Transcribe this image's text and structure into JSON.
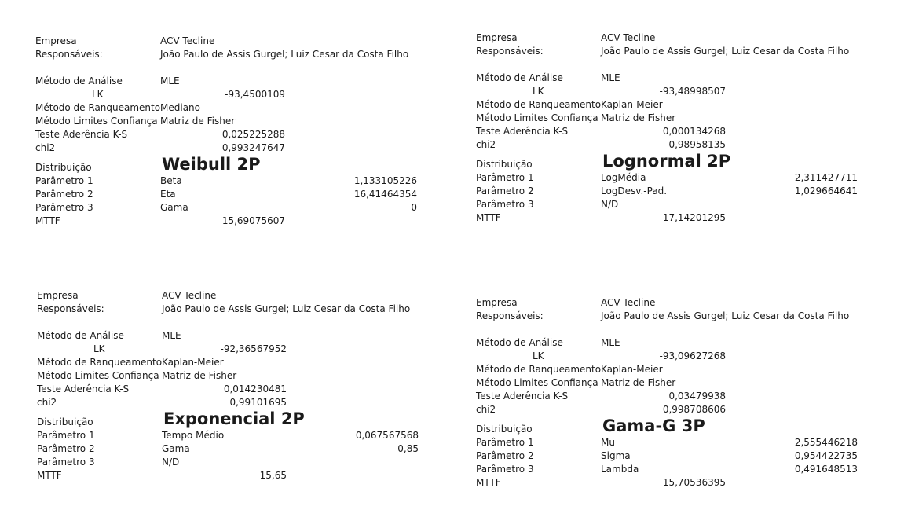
{
  "panels": [
    {
      "company_label": "Empresa",
      "company": "ACV Tecline",
      "responsible_label": "Responsáveis:",
      "responsible": "João Paulo de Assis Gurgel; Luiz Cesar da Costa Filho",
      "method_label": "Método de Análise",
      "method": "MLE",
      "lk_label": "LK",
      "lk": "-93,4500109",
      "ranking_label": "Método de Ranqueamento",
      "ranking": "Mediano",
      "conf_label": "Método Limites Confiança",
      "conf": "Matriz de Fisher",
      "ks_label": "Teste Aderência  K-S",
      "ks": "0,025225288",
      "chi2_label": "chi2",
      "chi2": "0,993247647",
      "dist_label": "Distribuição",
      "dist": "Weibull 2P",
      "p1_label": "Parâmetro 1",
      "p1_name": "Beta",
      "p1_value": "1,133105226",
      "p2_label": "Parâmetro 2",
      "p2_name": "Eta",
      "p2_value": "16,41464354",
      "p3_label": "Parâmetro 3",
      "p3_name": "Gama",
      "p3_value": "0",
      "mttf_label": "MTTF",
      "mttf": "15,69075607"
    },
    {
      "company_label": "Empresa",
      "company": "ACV Tecline",
      "responsible_label": "Responsáveis:",
      "responsible": "João Paulo de Assis Gurgel; Luiz Cesar da Costa Filho",
      "method_label": "Método de Análise",
      "method": "MLE",
      "lk_label": "LK",
      "lk": "-93,48998507",
      "ranking_label": "Método de Ranqueamento",
      "ranking": "Kaplan-Meier",
      "conf_label": "Método Limites Confiança",
      "conf": "Matriz de Fisher",
      "ks_label": "Teste Aderência  K-S",
      "ks": "0,000134268",
      "chi2_label": "chi2",
      "chi2": "0,98958135",
      "dist_label": "Distribuição",
      "dist": "Lognormal 2P",
      "p1_label": "Parâmetro 1",
      "p1_name": "LogMédia",
      "p1_value": "2,311427711",
      "p2_label": "Parâmetro 2",
      "p2_name": "LogDesv.-Pad.",
      "p2_value": "1,029664641",
      "p3_label": "Parâmetro 3",
      "p3_name": "N/D",
      "p3_value": "",
      "mttf_label": "MTTF",
      "mttf": "17,14201295"
    },
    {
      "company_label": "Empresa",
      "company": "ACV Tecline",
      "responsible_label": "Responsáveis:",
      "responsible": "João Paulo de Assis Gurgel; Luiz Cesar da Costa Filho",
      "method_label": "Método de Análise",
      "method": "MLE",
      "lk_label": "LK",
      "lk": "-92,36567952",
      "ranking_label": "Método de Ranqueamento",
      "ranking": "Kaplan-Meier",
      "conf_label": "Método Limites Confiança",
      "conf": "Matriz de Fisher",
      "ks_label": "Teste Aderência  K-S",
      "ks": "0,014230481",
      "chi2_label": "chi2",
      "chi2": "0,99101695",
      "dist_label": "Distribuição",
      "dist": "Exponencial 2P",
      "p1_label": "Parâmetro 1",
      "p1_name": "Tempo Médio",
      "p1_value": "0,067567568",
      "p2_label": "Parâmetro 2",
      "p2_name": "Gama",
      "p2_value": "0,85",
      "p3_label": "Parâmetro 3",
      "p3_name": "N/D",
      "p3_value": "",
      "mttf_label": "MTTF",
      "mttf": "15,65"
    },
    {
      "company_label": "Empresa",
      "company": "ACV Tecline",
      "responsible_label": "Responsáveis:",
      "responsible": "João Paulo de Assis Gurgel; Luiz Cesar da Costa Filho",
      "method_label": "Método de Análise",
      "method": "MLE",
      "lk_label": "LK",
      "lk": "-93,09627268",
      "ranking_label": "Método de Ranqueamento",
      "ranking": "Kaplan-Meier",
      "conf_label": "Método Limites Confiança",
      "conf": "Matriz de Fisher",
      "ks_label": "Teste Aderência  K-S",
      "ks": "0,03479938",
      "chi2_label": "chi2",
      "chi2": "0,998708606",
      "dist_label": "Distribuição",
      "dist": "Gama-G 3P",
      "p1_label": "Parâmetro 1",
      "p1_name": "Mu",
      "p1_value": "2,555446218",
      "p2_label": "Parâmetro 2",
      "p2_name": "Sigma",
      "p2_value": "0,954422735",
      "p3_label": "Parâmetro 3",
      "p3_name": "Lambda",
      "p3_value": "0,491648513",
      "mttf_label": "MTTF",
      "mttf": "15,70536395"
    }
  ]
}
